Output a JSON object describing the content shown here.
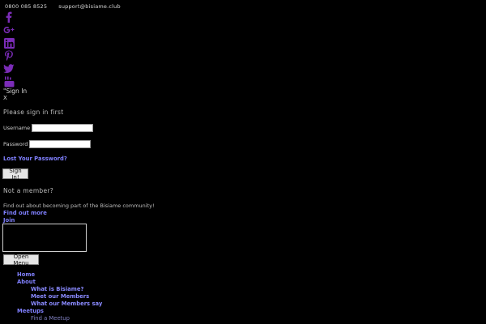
{
  "header": {
    "phone": "0800 085 8525",
    "email": "support@bisiame.club"
  },
  "social": [
    {
      "icon": "facebook-icon"
    },
    {
      "icon": "google-plus-icon"
    },
    {
      "icon": "linkedin-icon"
    },
    {
      "icon": "pinterest-icon"
    },
    {
      "icon": "twitter-icon"
    },
    {
      "icon": "youtube-icon"
    }
  ],
  "signin": {
    "link_label": "Sign In",
    "close_label": "X",
    "prompt": "Please sign in first",
    "username_label": "Username",
    "username_value": "",
    "password_label": "Password",
    "password_value": "",
    "lost_password": "Lost Your Password?",
    "button_label": "Sign In!"
  },
  "membership": {
    "heading": "Not a member?",
    "blurb": "Find out about becoming part of the Bisiame community!",
    "find_out_more": "Find out more",
    "join": "Join"
  },
  "menu": {
    "button_label": "Open Menu",
    "items": [
      {
        "label": "Home",
        "level": 0
      },
      {
        "label": "About",
        "level": 0
      },
      {
        "label": "What is Bisiame?",
        "level": 1
      },
      {
        "label": "Meet our Members",
        "level": 1
      },
      {
        "label": "What our Members say",
        "level": 1
      },
      {
        "label": "Meetups",
        "level": 0
      },
      {
        "label": "Find a Meetup",
        "level": 1
      }
    ]
  },
  "colors": {
    "background": "#000000",
    "link": "#8080ff",
    "social_icon": "#7b2cb8"
  }
}
